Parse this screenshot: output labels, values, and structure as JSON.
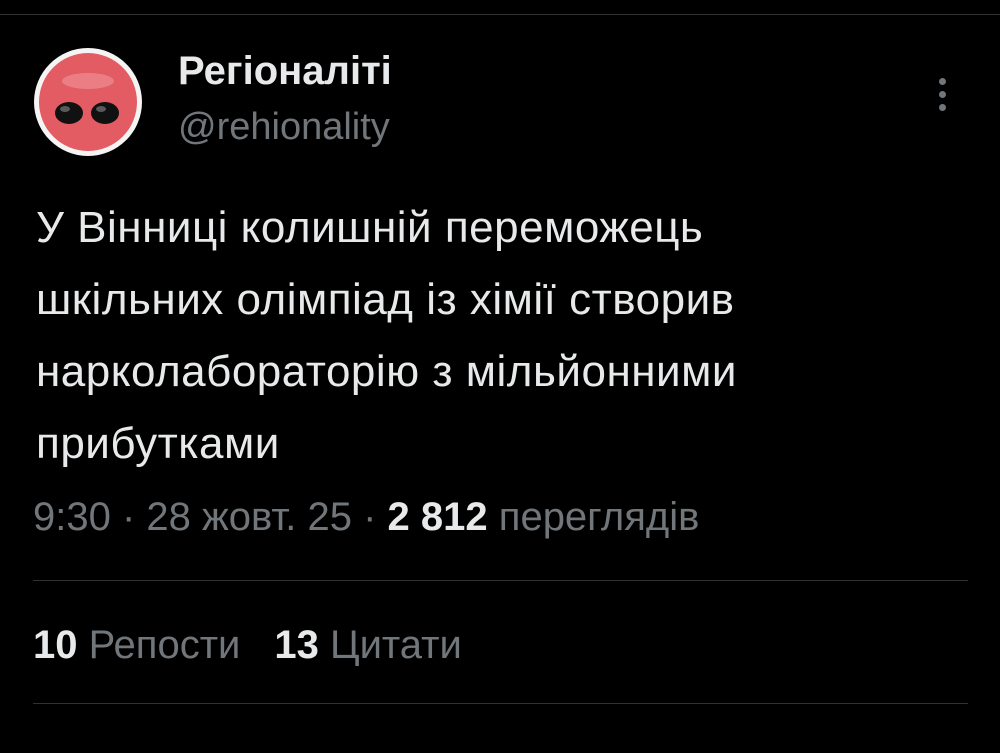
{
  "author": {
    "name": "Регіоналіті",
    "handle": "@rehionality",
    "avatar_icon": "red-face-avatar-icon"
  },
  "more_icon": "more-vertical-icon",
  "tweet": {
    "text": "У Вінниці колишній переможець\nшкільних олімпіад із хімії створив\nнарколабораторію з мільйонними\nприбутками"
  },
  "meta": {
    "time": "9:30",
    "separator": " · ",
    "date": "28 жовт. 25",
    "views_count": "2 812",
    "views_label": "переглядів"
  },
  "stats": {
    "reposts_count": "10",
    "reposts_label": "Репости",
    "quotes_count": "13",
    "quotes_label": "Цитати"
  },
  "colors": {
    "background": "#000000",
    "text": "#e7e9ea",
    "secondary_text": "#71767b",
    "divider": "#2f3336",
    "avatar_red": "#e35b63"
  }
}
